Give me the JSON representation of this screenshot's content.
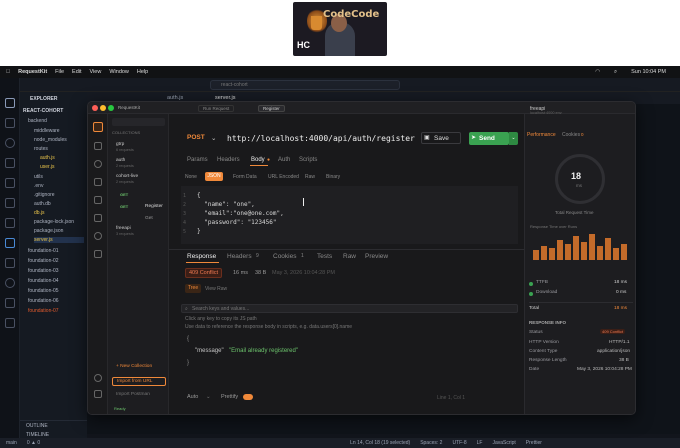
{
  "webcam": {
    "brand": "CodeCode",
    "initials": "HC"
  },
  "menubar": {
    "items": [
      "RequestKit",
      "File",
      "Edit",
      "View",
      "Window",
      "Help"
    ],
    "clock": "Sun 10:04 PM"
  },
  "vscode": {
    "search_placeholder": "react-cohort",
    "tabs": [
      "auth.js",
      "server.js"
    ],
    "explorer_title": "EXPLORER",
    "project": "REACT-COHORT",
    "tree": [
      "backend",
      "middleware",
      "node_modules",
      "routes",
      "auth.js",
      "user.js",
      "utils",
      ".env",
      ".gitignore",
      "auth.db",
      "db.js",
      "package-lock.json",
      "package.json",
      "server.js",
      "foundation-01",
      "foundation-02",
      "foundation-03",
      "foundation-04",
      "foundation-05",
      "foundation-06",
      "foundation-07"
    ],
    "outline": "OUTLINE",
    "timeline": "TIMELINE",
    "status_left": [
      "main",
      "0 ▲ 0",
      "Ln 14, Col 18 (19 selected)",
      "Spaces: 2",
      "UTF-8",
      "LF",
      "JavaScript",
      "Prettier"
    ]
  },
  "rk": {
    "title": "RequestKit",
    "tabs": [
      "Run Request",
      "Register"
    ],
    "collections_header": "COLLECTIONS",
    "collections": [
      {
        "name": "gtrp",
        "sub": "6 requests"
      },
      {
        "name": "auth",
        "sub": "2 requests"
      },
      {
        "name": "cohort-live",
        "sub": "2 requests"
      },
      {
        "name": "freeapi",
        "sub": "3 requests"
      }
    ],
    "col_requests": [
      {
        "method": "GET",
        "name": "Register"
      },
      {
        "method": "GET",
        "name": "Get"
      }
    ],
    "new_collection": "+ New Collection",
    "import_url": "Import from URL",
    "import_postman": "Import Postman",
    "ready": "Ready",
    "env_name": "freeapi",
    "env_sub": "localhost:4000 env",
    "request": {
      "method": "POST",
      "url": "http://localhost:4000/api/auth/register",
      "save": "Save",
      "send": "Send",
      "tabs": [
        "Params",
        "Headers",
        "Body",
        "Auth",
        "Scripts"
      ],
      "body_types": [
        "None",
        "JSON",
        "Form Data",
        "URL Encoded",
        "Raw",
        "Binary"
      ],
      "body_lines": [
        "{",
        "  \"name\": \"one\",",
        "  \"email\":\"one@one.com\",",
        "  \"password\": \"123456\"",
        "}"
      ]
    },
    "response": {
      "tabs": [
        "Response",
        "Headers",
        "Cookies",
        "Tests",
        "Raw",
        "Preview"
      ],
      "headers_count": "9",
      "cookies_count": "1",
      "status": "409 Conflict",
      "time": "16 ms",
      "size": "38 B",
      "date": "May 3, 2026 10:04:28 PM",
      "view_tabs": [
        "Tree",
        "View Raw"
      ],
      "filter_placeholder": "Search keys and values...",
      "hint1": "Click any key to copy its JS path",
      "hint2": "Use data to reference the response body in scripts, e.g. data.users[0].name",
      "body_key": "\"message\"",
      "body_value": "\"Email already registered\"",
      "auto": "Auto",
      "prettify": "Prettify",
      "cursor": "Line 1, Col 1"
    },
    "perf": {
      "tabs": [
        "Performance",
        "Cookies"
      ],
      "cookies_count": "0",
      "total_ms": "18",
      "ms_label": "ms",
      "total_label": "Total Request Time",
      "chart_label": "Response Time over Runs",
      "ttfb_label": "TTFB",
      "ttfb_value": "18 ms",
      "download_label": "Download",
      "download_value": "0 ms",
      "total_row_label": "Total",
      "total_row_value": "18 ms",
      "info_header": "RESPONSE INFO",
      "info": [
        {
          "k": "Status",
          "v": "409 Conflict"
        },
        {
          "k": "HTTP Version",
          "v": "HTTP/1.1"
        },
        {
          "k": "Content Type",
          "v": "application/json"
        },
        {
          "k": "Response Length",
          "v": "38 B"
        },
        {
          "k": "Date",
          "v": "May 3, 2026 10:04:28 PM"
        }
      ]
    }
  },
  "colors": {
    "accent": "#f0893a",
    "send": "#3aa251",
    "conflict": "#e35b2e"
  }
}
